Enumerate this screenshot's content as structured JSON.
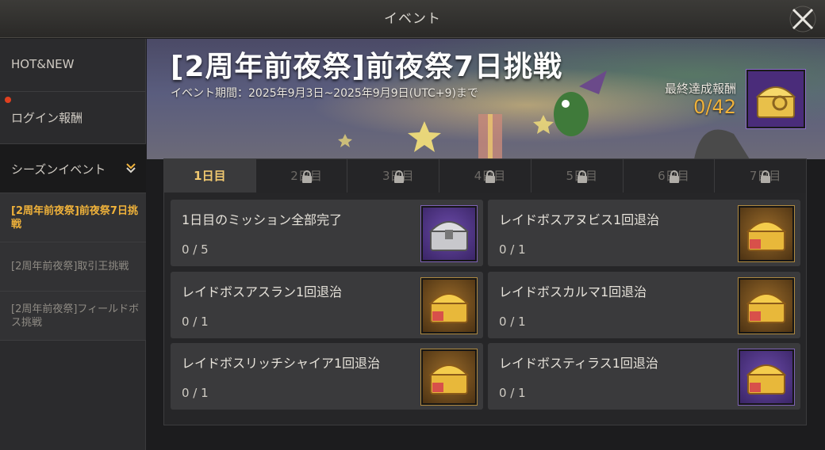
{
  "window": {
    "title": "イベント"
  },
  "sidebar": {
    "items": [
      {
        "label": "HOT&NEW"
      },
      {
        "label": "ログイン報酬"
      },
      {
        "label": "シーズンイベント"
      }
    ],
    "sub_items": [
      {
        "label": "[2周年前夜祭]前夜祭7日挑戦"
      },
      {
        "label": "[2周年前夜祭]取引王挑戦"
      },
      {
        "label": "[2周年前夜祭]フィールドボス挑戦"
      }
    ]
  },
  "banner": {
    "title": "[2周年前夜祭]前夜祭7日挑戦",
    "period": "イベント期間：2025年9月3日~2025年9月9日(UTC+9)まで",
    "final_reward_label": "最終達成報酬",
    "final_reward_count": "0/42"
  },
  "tabs": [
    {
      "label": "1日目",
      "locked": false
    },
    {
      "label": "2日目",
      "locked": true
    },
    {
      "label": "3日目",
      "locked": true
    },
    {
      "label": "4日目",
      "locked": true
    },
    {
      "label": "5日目",
      "locked": true
    },
    {
      "label": "6日目",
      "locked": true
    },
    {
      "label": "7日目",
      "locked": true
    }
  ],
  "missions": [
    {
      "name": "1日目のミッション全部完了",
      "progress": "0 / 5",
      "reward_icon": "silver-chest-icon"
    },
    {
      "name": "レイドボスアヌビス1回退治",
      "progress": "0 / 1",
      "reward_icon": "gold-chest-icon"
    },
    {
      "name": "レイドボスアスラン1回退治",
      "progress": "0 / 1",
      "reward_icon": "gold-chest-icon"
    },
    {
      "name": "レイドボスカルマ1回退治",
      "progress": "0 / 1",
      "reward_icon": "gold-chest-icon"
    },
    {
      "name": "レイドボスリッチシャイア1回退治",
      "progress": "0 / 1",
      "reward_icon": "gold-chest-icon"
    },
    {
      "name": "レイドボスティラス1回退治",
      "progress": "0 / 1",
      "reward_icon": "gold-chest-icon"
    }
  ],
  "colors": {
    "accent": "#f0b23a",
    "active_tab_text": "#f0c870",
    "notify_dot": "#e0401f"
  }
}
